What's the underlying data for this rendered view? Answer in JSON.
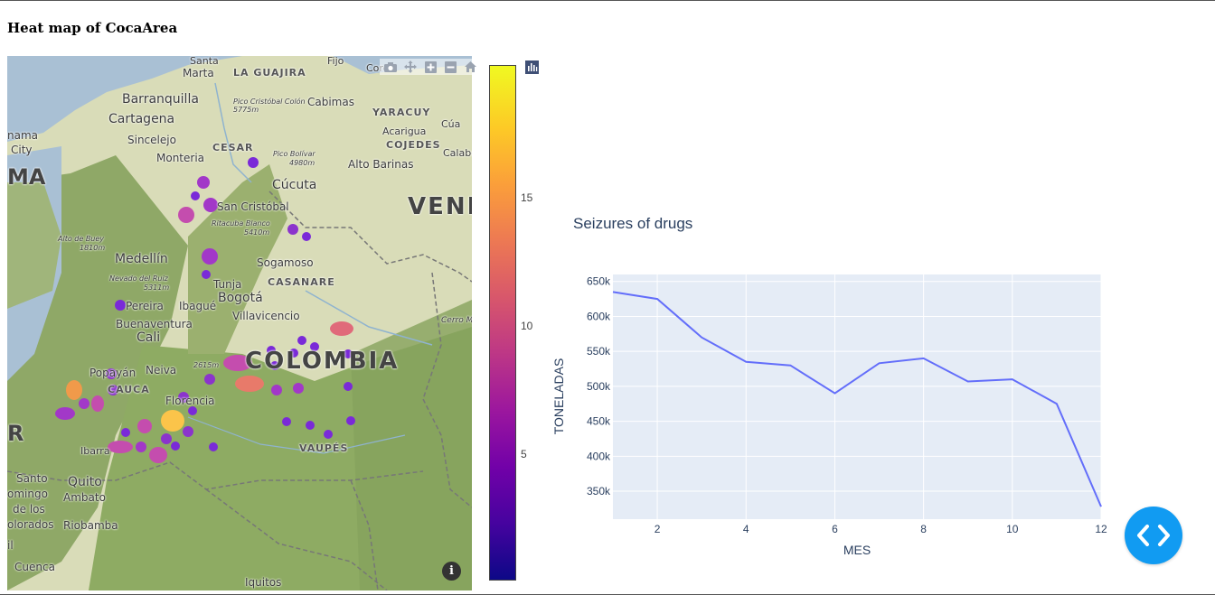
{
  "page": {
    "title": "Heat map of CocaArea"
  },
  "map": {
    "place_labels": [
      "Santa",
      "Marta",
      "LA GUAJIRA",
      "Fijo",
      "Coro",
      "Barranquilla",
      "Pico Cristóbal Colón",
      "5775m",
      "Cabimas",
      "Cartagena",
      "YARACUY",
      "Cúa",
      "Acarigua",
      "Sincelejo",
      "CESAR",
      "COJEDES",
      "Calabo",
      "Monteria",
      "Pico Bolívar",
      "4980m",
      "Alto Barinas",
      "Cúcuta",
      "VENE",
      "San Cristóbal",
      "Ritacuba Blanco",
      "5410m",
      "Alto de Buey",
      "1810m",
      "Medellín",
      "Sogamoso",
      "Nevado del Ruiz",
      "5311m",
      "Tunja",
      "CASANARE",
      "Pereira",
      "Ibagué",
      "Bogotá",
      "Villavicencio",
      "Buenaventura",
      "Cali",
      "Cerro M",
      "Popayán",
      "Neiva",
      "2615m",
      "COLOMBIA",
      "CAUCA",
      "Florencia",
      "Ibarra",
      "VAUPÉS",
      "Santo",
      "omingo",
      "de los",
      "olorados",
      "Quito",
      "Ambato",
      "Riobamba",
      "Cuenca",
      "Iquitos",
      "nama",
      "City",
      "MA",
      "R",
      "il"
    ],
    "info_button": "i",
    "modebar": [
      "camera-icon",
      "pan-icon",
      "zoom-in-icon",
      "zoom-out-icon",
      "home-icon",
      "plotly-logo-icon"
    ]
  },
  "colorbar": {
    "ticks": [
      "15",
      "10",
      "5"
    ],
    "colorscale": [
      "#0d0887",
      "#46039f",
      "#7201a8",
      "#9c179e",
      "#bd3786",
      "#d8576b",
      "#ed7953",
      "#fb9f3a",
      "#fdca26",
      "#f0f921"
    ],
    "range": [
      0,
      20
    ]
  },
  "chart_data": {
    "type": "line",
    "title": "Seizures of drugs",
    "xlabel": "MES",
    "ylabel": "TONELADAS",
    "x": [
      1,
      2,
      3,
      4,
      5,
      6,
      7,
      8,
      9,
      10,
      11,
      12
    ],
    "series": [
      {
        "values": [
          635000,
          625000,
          570000,
          535000,
          530000,
          490000,
          533000,
          540000,
          507000,
          510000,
          475000,
          328000
        ]
      }
    ],
    "xticks": [
      "2",
      "4",
      "6",
      "8",
      "10",
      "12"
    ],
    "yticks": [
      "350k",
      "400k",
      "450k",
      "500k",
      "550k",
      "600k",
      "650k"
    ],
    "xlim": [
      1,
      12
    ],
    "ylim": [
      310000,
      660000
    ],
    "line_color": "#636efa",
    "plot_bg": "#e5ecf6",
    "grid": true
  }
}
